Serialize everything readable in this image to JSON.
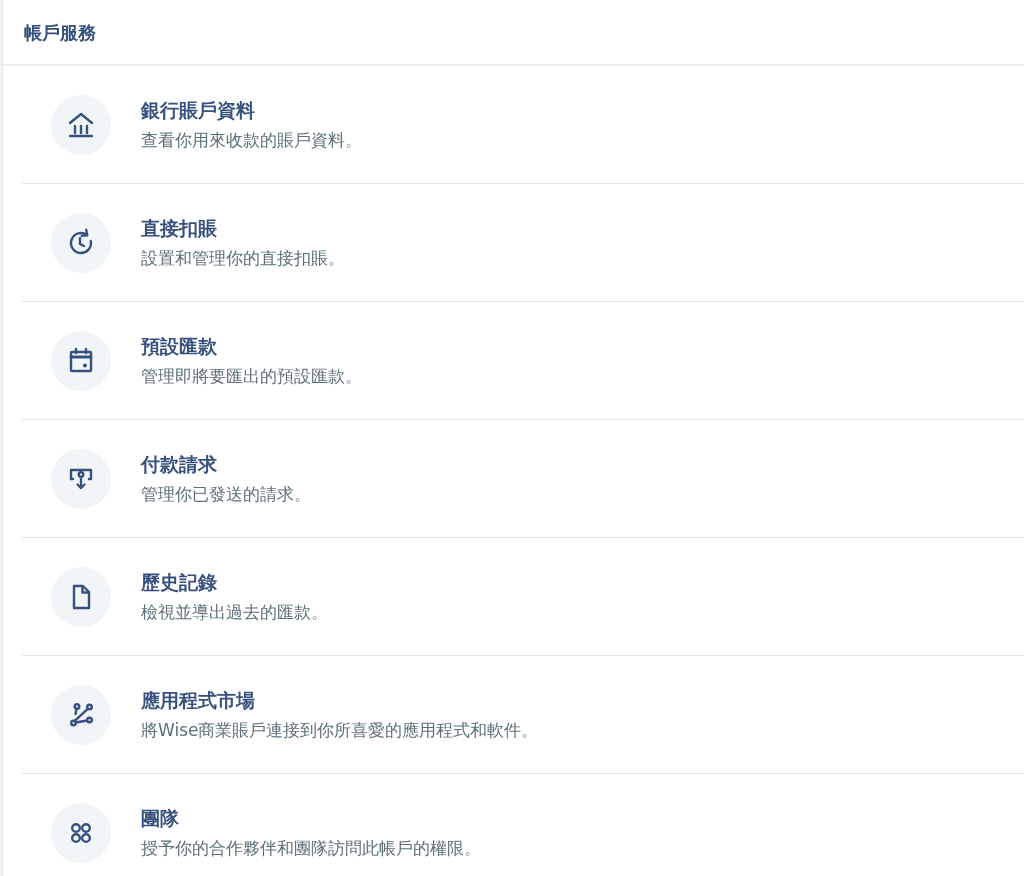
{
  "panel": {
    "title": "帳戶服務"
  },
  "services": [
    {
      "kind": "bank",
      "title": "銀行賬戶資料",
      "description": "查看你用來收款的賬戶資料。"
    },
    {
      "kind": "recurring",
      "title": "直接扣賬",
      "description": "設置和管理你的直接扣賬。"
    },
    {
      "kind": "calendar",
      "title": "預設匯款",
      "description": "管理即將要匯出的預設匯款。"
    },
    {
      "kind": "request",
      "title": "付款請求",
      "description": "管理你已發送的請求。"
    },
    {
      "kind": "document",
      "title": "歷史記錄",
      "description": "檢視並導出過去的匯款。"
    },
    {
      "kind": "integrations",
      "title": "應用程式市場",
      "description": "將Wise商業賬戶連接到你所喜愛的應用程式和軟件。"
    },
    {
      "kind": "team",
      "title": "團隊",
      "description": "授予你的合作夥伴和團隊訪問此帳戶的權限。"
    }
  ]
}
